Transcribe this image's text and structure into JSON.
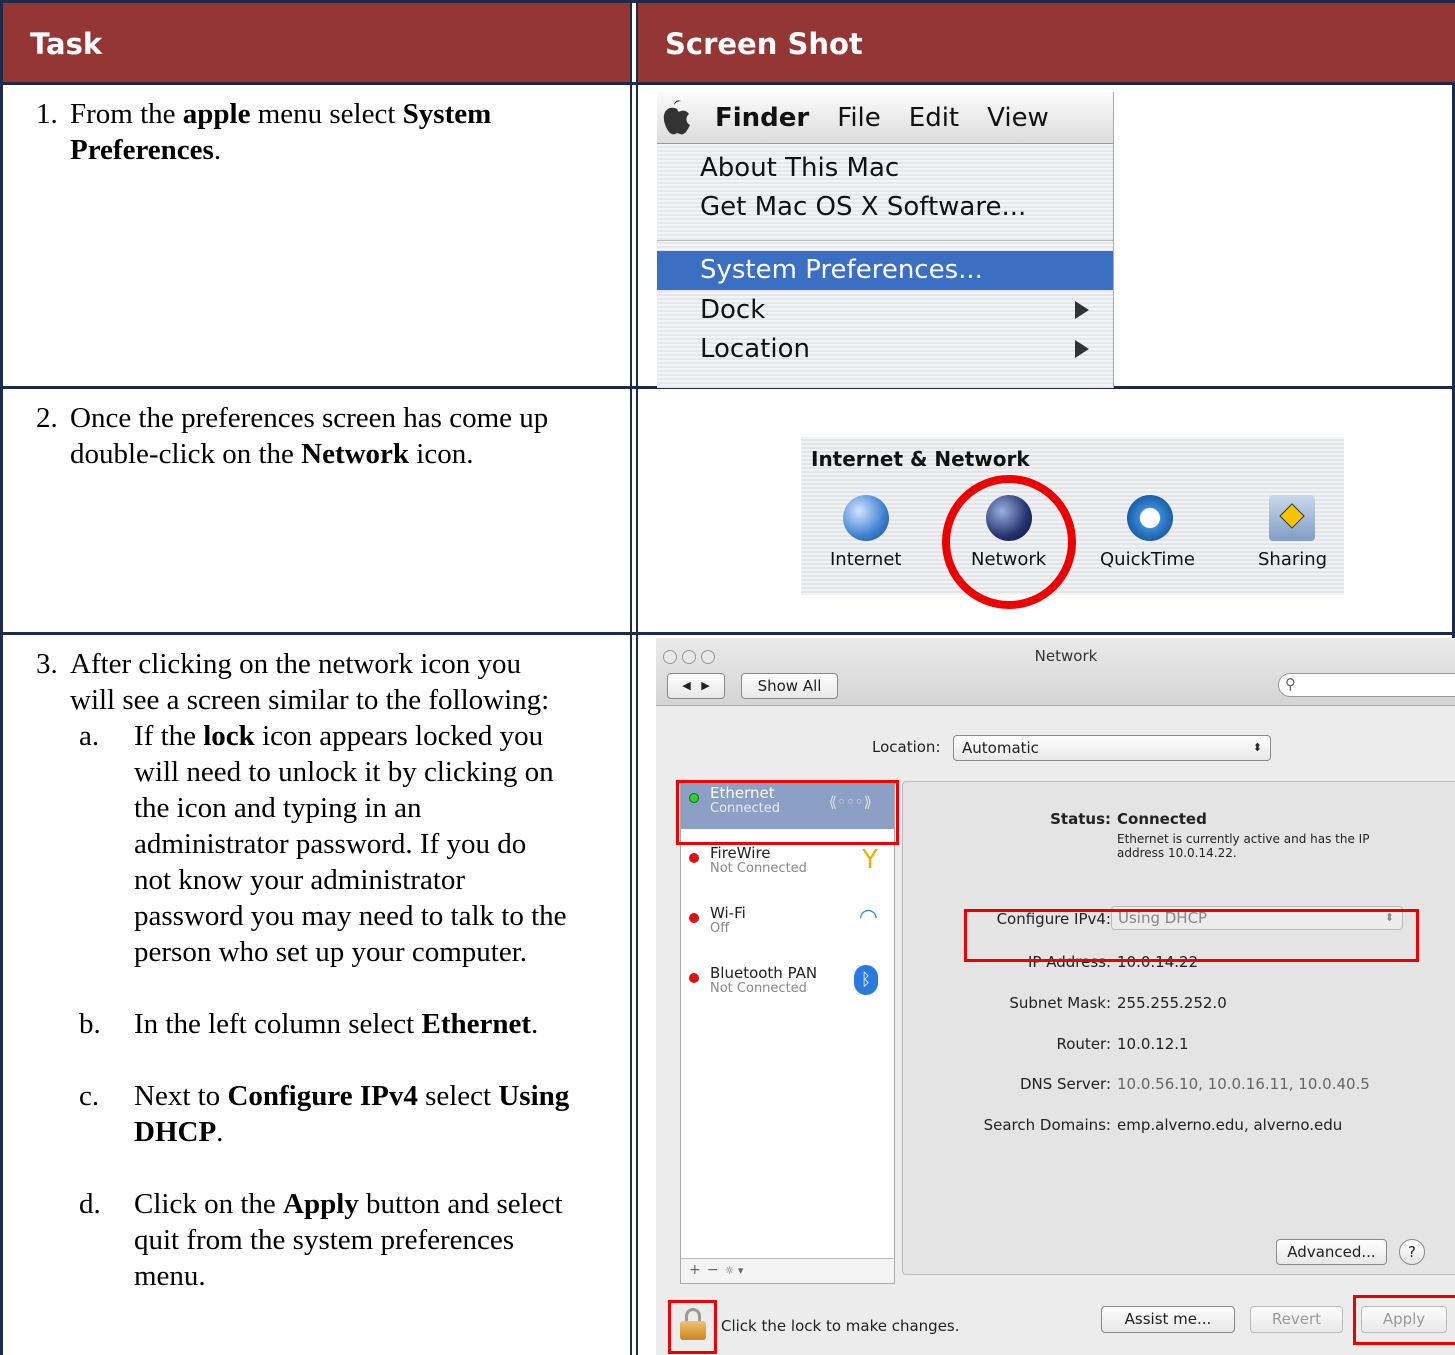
{
  "headers": {
    "task": "Task",
    "screenshot": "Screen Shot"
  },
  "step1": {
    "num": "1.",
    "t1": "From the ",
    "b1": "apple",
    "t2": " menu select ",
    "b2": "System",
    "b3": "Preferences",
    "t3": "."
  },
  "step2": {
    "num": "2.",
    "line1": "Once the preferences screen has come up",
    "t1": "double-click on the ",
    "b1": "Network",
    "t2": " icon."
  },
  "step3": {
    "num": "3.",
    "line1": "After clicking on the network icon you",
    "line2": "will see a screen similar to the following:",
    "a": {
      "letter": "a.",
      "t1": "If the ",
      "b1": "lock",
      "t2": " icon appears locked you",
      "l2": "will need to unlock it by clicking on",
      "l3": "the icon and typing in an",
      "l4": "administrator password.  If you do",
      "l5": "not know your administrator",
      "l6": "password you may need to talk to the",
      "l7": "person who set up your computer."
    },
    "b": {
      "letter": "b.",
      "t1": "In the left column select ",
      "b1": "Ethernet",
      "t2": "."
    },
    "c": {
      "letter": "c.",
      "t1": "Next to ",
      "b1": "Configure IPv4",
      "t2": " select ",
      "b2": "Using",
      "b3": "DHCP",
      "t3": "."
    },
    "d": {
      "letter": "d.",
      "t1": "Click on the ",
      "b1": "Apply",
      "t2": " button and select",
      "l2": "quit from the system preferences",
      "l3": "menu."
    }
  },
  "menu": {
    "apple_icon": "apple-logo-icon",
    "bar": [
      "Finder",
      "File",
      "Edit",
      "View"
    ],
    "items": [
      "About This Mac",
      "Get Mac OS X Software...",
      "System Preferences...",
      "Dock",
      "Location"
    ]
  },
  "prefs": {
    "title": "Internet & Network",
    "icons": [
      "Internet",
      "Network",
      "QuickTime",
      "Sharing"
    ]
  },
  "network": {
    "title": "Network",
    "show_all": "Show All",
    "location_label": "Location:",
    "location_value": "Automatic",
    "services": [
      {
        "name": "Ethernet",
        "status": "Connected"
      },
      {
        "name": "FireWire",
        "status": "Not Connected"
      },
      {
        "name": "Wi-Fi",
        "status": "Off"
      },
      {
        "name": "Bluetooth PAN",
        "status": "Not Connected"
      }
    ],
    "status_label": "Status:",
    "status_value": "Connected",
    "status_desc1": "Ethernet is currently active and has the IP",
    "status_desc2": "address 10.0.14.22.",
    "configure_label": "Configure IPv4:",
    "configure_value": "Using DHCP",
    "ip_label": "IP Address:",
    "ip_value": "10.0.14.22",
    "subnet_label": "Subnet Mask:",
    "subnet_value": "255.255.252.0",
    "router_label": "Router:",
    "router_value": "10.0.12.1",
    "dns_label": "DNS Server:",
    "dns_value": "10.0.56.10, 10.0.16.11, 10.0.40.5",
    "search_label": "Search Domains:",
    "search_value": "emp.alverno.edu, alverno.edu",
    "advanced": "Advanced...",
    "help": "?",
    "lock_text": "Click the lock to make changes.",
    "assist": "Assist me...",
    "revert": "Revert",
    "apply": "Apply",
    "add": "+",
    "remove": "−",
    "gear": "☼ ▾"
  },
  "colors": {
    "header": "#943634",
    "highlight": "#e00000",
    "selection": "#3a6fc4"
  }
}
